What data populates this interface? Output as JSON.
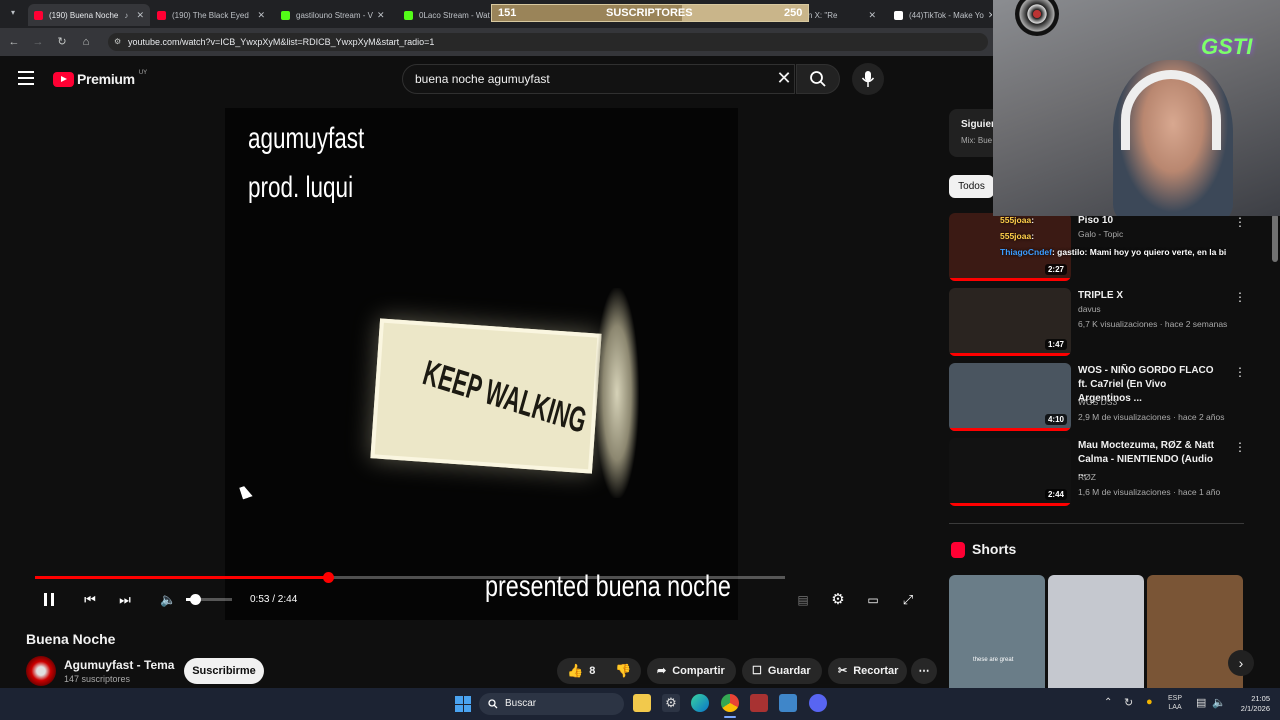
{
  "tabs": [
    {
      "label": "(190) Buena Noche",
      "active": true,
      "favicon_color": "#ff0033"
    },
    {
      "label": "(190) The Black Eyed",
      "favicon_color": "#ff0033"
    },
    {
      "label": "gastilouno Stream - V",
      "favicon_color": "#53fc18"
    },
    {
      "label": "0Laco Stream - Watc",
      "favicon_color": "#53fc18"
    },
    {
      "label": "TENGO",
      "favicon_color": "#444444"
    },
    {
      "label": "ias en X: \"Re",
      "favicon_color": "#ffffff"
    },
    {
      "label": "(44)TikTok - Make Yo",
      "favicon_color": "#ffffff"
    }
  ],
  "address_bar": {
    "url": "youtube.com/watch?v=ICB_YwxpXyM&list=RDICB_YwxpXyM&start_radio=1"
  },
  "stream_overlay": {
    "left_count": "151",
    "label": "SUSCRIPTORES",
    "goal": "250",
    "progress_fraction": 0.6
  },
  "header": {
    "logo_text": "Premium",
    "country": "UY",
    "search_value": "buena noche agumuyfast"
  },
  "video": {
    "overlay_lines": [
      "agumuyfast",
      "prod. luqui"
    ],
    "sign_text": "KEEP WALKING",
    "caption": "presented buena noche",
    "current_time": "0:53",
    "duration": "2:44",
    "time_display": "0:53 / 2:44",
    "progress_fraction": 0.39,
    "volume_fraction": 0.2
  },
  "video_info": {
    "title": "Buena Noche",
    "channel": "Agumuyfast - Tema",
    "subscribers": "147 suscriptores",
    "subscribe_label": "Suscribirme",
    "like_count": "8",
    "share_label": "Compartir",
    "save_label": "Guardar",
    "clip_label": "Recortar"
  },
  "sidebar": {
    "next_label": "Siguier",
    "mix_label": "Mix: Bue",
    "filter_all": "Todos",
    "recommendations": [
      {
        "title": "Piso 10",
        "channel": "Galo - Topic",
        "meta": "",
        "duration": "2:27",
        "thumb_color": "#3b1a14"
      },
      {
        "title": "TRIPLE X",
        "channel": "davus",
        "meta": "6,7 K visualizaciones · hace 2 semanas",
        "duration": "1:47",
        "thumb_color": "#2a2420"
      },
      {
        "title": "WOS - NIÑO GORDO FLACO ft. Ca7riel (En Vivo Argentinos ...",
        "channel": "WOS DS3",
        "meta": "2,9 M de visualizaciones · hace 2 años",
        "duration": "4:10",
        "thumb_color": "#4a5560"
      },
      {
        "title": "Mau Moctezuma, RØZ & Natt Calma - NIENTIENDO (Audio ...",
        "channel": "RØZ",
        "meta": "1,6 M de visualizaciones · hace 1 año",
        "duration": "2:44",
        "thumb_color": "#121212"
      }
    ],
    "shorts_label": "Shorts",
    "shorts": [
      {
        "caption": "these are great",
        "color": "#6a7d88"
      },
      {
        "caption": "",
        "color": "#c5c8cf"
      },
      {
        "caption": "",
        "color": "#7a5536"
      }
    ]
  },
  "chat": [
    {
      "user": "555joaa",
      "message": ""
    },
    {
      "user": "555joaa",
      "message": ""
    },
    {
      "user": "ThiagoCndef",
      "message": "gastilo: Mami hoy yo quiero verte, en la bi"
    }
  ],
  "webcam": {
    "brand": "GSTI"
  },
  "taskbar": {
    "search_placeholder": "Buscar",
    "lang_top": "ESP",
    "lang_bottom": "LAA",
    "time": "21:05",
    "date": "2/1/2026"
  }
}
